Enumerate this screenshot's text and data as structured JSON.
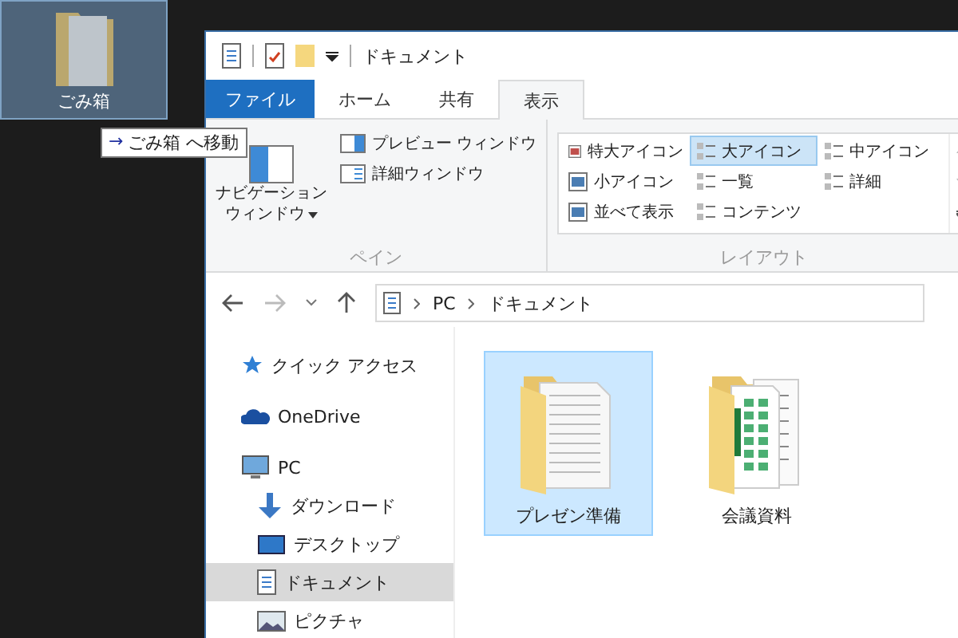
{
  "drag_ghost": {
    "label": "ごみ箱"
  },
  "drag_tooltip": {
    "arrow": "→",
    "text": "ごみ箱 へ移動"
  },
  "window": {
    "title": "ドキュメント"
  },
  "ribbon_tabs": [
    {
      "label": "ファイル",
      "kind": "file"
    },
    {
      "label": "ホーム",
      "kind": "tab",
      "selected": false
    },
    {
      "label": "共有",
      "kind": "tab",
      "selected": false
    },
    {
      "label": "表示",
      "kind": "tab",
      "selected": true
    }
  ],
  "pane_group": {
    "label": "ペイン",
    "navigation_pane": {
      "lines": [
        "ナビゲーション",
        "ウィンドウ"
      ]
    },
    "items": [
      {
        "label": "プレビュー ウィンドウ",
        "kind": "preview"
      },
      {
        "label": "詳細ウィンドウ",
        "kind": "details"
      }
    ]
  },
  "layout_group": {
    "label": "レイアウト",
    "options": [
      {
        "label": "特大アイコン",
        "selected": false
      },
      {
        "label": "大アイコン",
        "selected": true
      },
      {
        "label": "中アイコン",
        "selected": false
      },
      {
        "label": "小アイコン",
        "selected": false
      },
      {
        "label": "一覧",
        "selected": false
      },
      {
        "label": "詳細",
        "selected": false
      },
      {
        "label": "並べて表示",
        "selected": false
      },
      {
        "label": "コンテンツ",
        "selected": false
      }
    ]
  },
  "address_bar": {
    "path": [
      "PC",
      "ドキュメント"
    ]
  },
  "nav_pane": {
    "items": [
      {
        "label": "クイック アクセス",
        "kind": "star",
        "selected": false
      },
      {
        "label": "OneDrive",
        "kind": "cloud",
        "selected": false
      },
      {
        "label": "PC",
        "kind": "monitor",
        "selected": false,
        "children": [
          {
            "label": "ダウンロード",
            "kind": "download",
            "selected": false
          },
          {
            "label": "デスクトップ",
            "kind": "desktop",
            "selected": false
          },
          {
            "label": "ドキュメント",
            "kind": "document",
            "selected": true
          },
          {
            "label": "ピクチャ",
            "kind": "picture",
            "selected": false
          }
        ]
      }
    ]
  },
  "items": [
    {
      "label": "プレゼン準備",
      "kind": "doc-folder",
      "selected": true
    },
    {
      "label": "会議資料",
      "kind": "sheet-folder",
      "selected": false
    }
  ]
}
